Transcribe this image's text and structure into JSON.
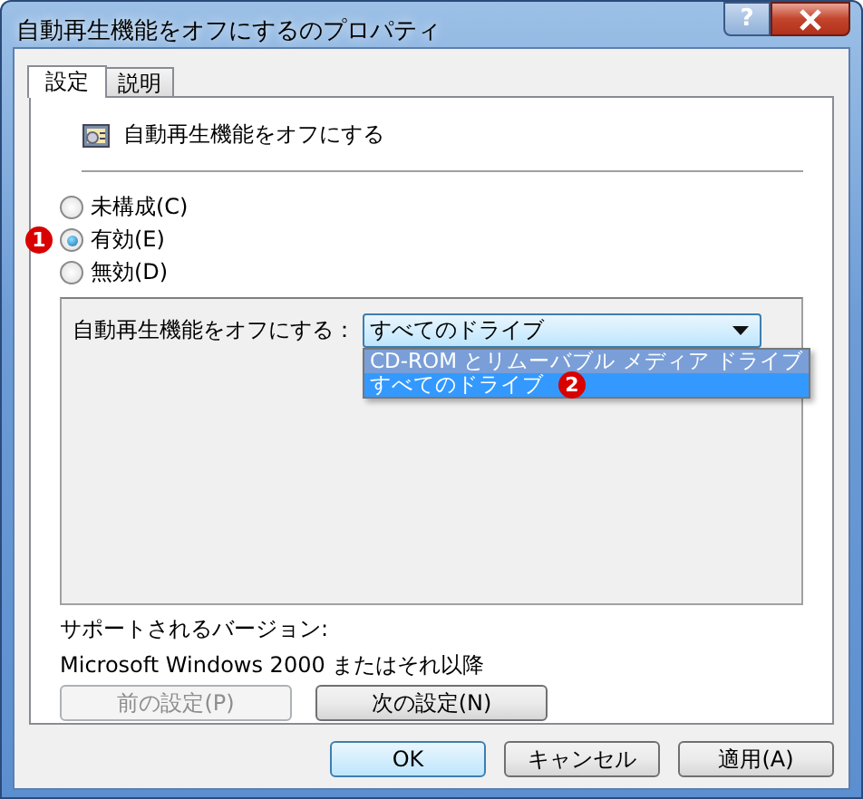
{
  "window": {
    "title": "自動再生機能をオフにするのプロパティ",
    "help_button": "?"
  },
  "tabs": [
    {
      "label": "設定",
      "selected": true
    },
    {
      "label": "説明",
      "selected": false
    }
  ],
  "policy": {
    "title": "自動再生機能をオフにする"
  },
  "options": [
    {
      "label": "未構成(C)",
      "selected": false
    },
    {
      "label": "有効(E)",
      "selected": true,
      "badge": "1"
    },
    {
      "label": "無効(D)",
      "selected": false
    }
  ],
  "settings": {
    "label": "自動再生機能をオフにする：",
    "value": "すべてのドライブ",
    "expanded": true,
    "items": [
      {
        "label": "CD-ROM とリムーバブル メディア ドライブ",
        "selected": false
      },
      {
        "label": "すべてのドライブ",
        "selected": true,
        "badge": "2"
      }
    ]
  },
  "supported": {
    "label": "サポートされるバージョン:",
    "value": "Microsoft Windows 2000 またはそれ以降"
  },
  "nav_buttons": [
    {
      "label": "前の設定(P)",
      "disabled": true
    },
    {
      "label": "次の設定(N)",
      "disabled": false
    }
  ],
  "buttons": [
    {
      "label": "OK",
      "default": true
    },
    {
      "label": "キャンセル",
      "default": false
    },
    {
      "label": "適用(A)",
      "default": false
    }
  ]
}
